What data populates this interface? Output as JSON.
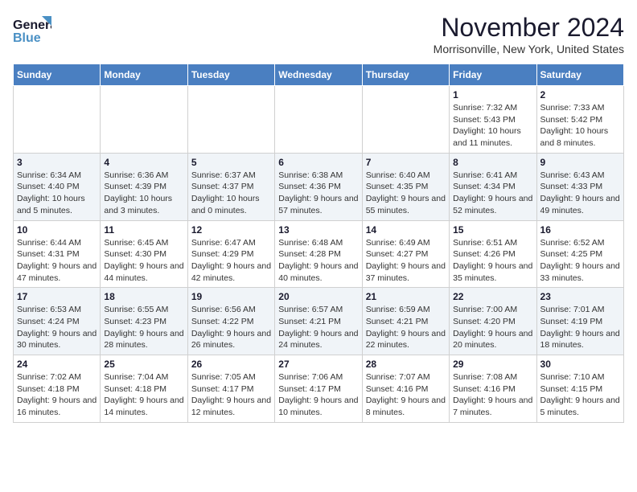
{
  "header": {
    "logo_line1": "General",
    "logo_line2": "Blue",
    "month_title": "November 2024",
    "location": "Morrisonville, New York, United States"
  },
  "days_of_week": [
    "Sunday",
    "Monday",
    "Tuesday",
    "Wednesday",
    "Thursday",
    "Friday",
    "Saturday"
  ],
  "weeks": [
    [
      {
        "day": "",
        "info": ""
      },
      {
        "day": "",
        "info": ""
      },
      {
        "day": "",
        "info": ""
      },
      {
        "day": "",
        "info": ""
      },
      {
        "day": "",
        "info": ""
      },
      {
        "day": "1",
        "info": "Sunrise: 7:32 AM\nSunset: 5:43 PM\nDaylight: 10 hours and 11 minutes."
      },
      {
        "day": "2",
        "info": "Sunrise: 7:33 AM\nSunset: 5:42 PM\nDaylight: 10 hours and 8 minutes."
      }
    ],
    [
      {
        "day": "3",
        "info": "Sunrise: 6:34 AM\nSunset: 4:40 PM\nDaylight: 10 hours and 5 minutes."
      },
      {
        "day": "4",
        "info": "Sunrise: 6:36 AM\nSunset: 4:39 PM\nDaylight: 10 hours and 3 minutes."
      },
      {
        "day": "5",
        "info": "Sunrise: 6:37 AM\nSunset: 4:37 PM\nDaylight: 10 hours and 0 minutes."
      },
      {
        "day": "6",
        "info": "Sunrise: 6:38 AM\nSunset: 4:36 PM\nDaylight: 9 hours and 57 minutes."
      },
      {
        "day": "7",
        "info": "Sunrise: 6:40 AM\nSunset: 4:35 PM\nDaylight: 9 hours and 55 minutes."
      },
      {
        "day": "8",
        "info": "Sunrise: 6:41 AM\nSunset: 4:34 PM\nDaylight: 9 hours and 52 minutes."
      },
      {
        "day": "9",
        "info": "Sunrise: 6:43 AM\nSunset: 4:33 PM\nDaylight: 9 hours and 49 minutes."
      }
    ],
    [
      {
        "day": "10",
        "info": "Sunrise: 6:44 AM\nSunset: 4:31 PM\nDaylight: 9 hours and 47 minutes."
      },
      {
        "day": "11",
        "info": "Sunrise: 6:45 AM\nSunset: 4:30 PM\nDaylight: 9 hours and 44 minutes."
      },
      {
        "day": "12",
        "info": "Sunrise: 6:47 AM\nSunset: 4:29 PM\nDaylight: 9 hours and 42 minutes."
      },
      {
        "day": "13",
        "info": "Sunrise: 6:48 AM\nSunset: 4:28 PM\nDaylight: 9 hours and 40 minutes."
      },
      {
        "day": "14",
        "info": "Sunrise: 6:49 AM\nSunset: 4:27 PM\nDaylight: 9 hours and 37 minutes."
      },
      {
        "day": "15",
        "info": "Sunrise: 6:51 AM\nSunset: 4:26 PM\nDaylight: 9 hours and 35 minutes."
      },
      {
        "day": "16",
        "info": "Sunrise: 6:52 AM\nSunset: 4:25 PM\nDaylight: 9 hours and 33 minutes."
      }
    ],
    [
      {
        "day": "17",
        "info": "Sunrise: 6:53 AM\nSunset: 4:24 PM\nDaylight: 9 hours and 30 minutes."
      },
      {
        "day": "18",
        "info": "Sunrise: 6:55 AM\nSunset: 4:23 PM\nDaylight: 9 hours and 28 minutes."
      },
      {
        "day": "19",
        "info": "Sunrise: 6:56 AM\nSunset: 4:22 PM\nDaylight: 9 hours and 26 minutes."
      },
      {
        "day": "20",
        "info": "Sunrise: 6:57 AM\nSunset: 4:21 PM\nDaylight: 9 hours and 24 minutes."
      },
      {
        "day": "21",
        "info": "Sunrise: 6:59 AM\nSunset: 4:21 PM\nDaylight: 9 hours and 22 minutes."
      },
      {
        "day": "22",
        "info": "Sunrise: 7:00 AM\nSunset: 4:20 PM\nDaylight: 9 hours and 20 minutes."
      },
      {
        "day": "23",
        "info": "Sunrise: 7:01 AM\nSunset: 4:19 PM\nDaylight: 9 hours and 18 minutes."
      }
    ],
    [
      {
        "day": "24",
        "info": "Sunrise: 7:02 AM\nSunset: 4:18 PM\nDaylight: 9 hours and 16 minutes."
      },
      {
        "day": "25",
        "info": "Sunrise: 7:04 AM\nSunset: 4:18 PM\nDaylight: 9 hours and 14 minutes."
      },
      {
        "day": "26",
        "info": "Sunrise: 7:05 AM\nSunset: 4:17 PM\nDaylight: 9 hours and 12 minutes."
      },
      {
        "day": "27",
        "info": "Sunrise: 7:06 AM\nSunset: 4:17 PM\nDaylight: 9 hours and 10 minutes."
      },
      {
        "day": "28",
        "info": "Sunrise: 7:07 AM\nSunset: 4:16 PM\nDaylight: 9 hours and 8 minutes."
      },
      {
        "day": "29",
        "info": "Sunrise: 7:08 AM\nSunset: 4:16 PM\nDaylight: 9 hours and 7 minutes."
      },
      {
        "day": "30",
        "info": "Sunrise: 7:10 AM\nSunset: 4:15 PM\nDaylight: 9 hours and 5 minutes."
      }
    ]
  ]
}
